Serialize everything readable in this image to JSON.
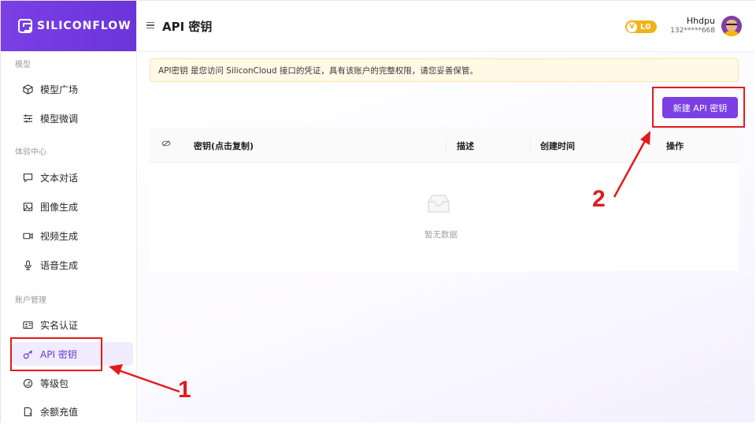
{
  "brand": {
    "logo_text": "SILICONFLOW"
  },
  "sidebar": {
    "sections": [
      {
        "label": "模型"
      },
      {
        "label": "体验中心"
      },
      {
        "label": "账户管理"
      }
    ],
    "items": [
      {
        "label": "模型广场",
        "icon": "cube-icon"
      },
      {
        "label": "模型微调",
        "icon": "sliders-icon"
      },
      {
        "label": "文本对话",
        "icon": "chat-icon"
      },
      {
        "label": "图像生成",
        "icon": "image-icon"
      },
      {
        "label": "视频生成",
        "icon": "video-icon"
      },
      {
        "label": "语音生成",
        "icon": "microphone-icon"
      },
      {
        "label": "实名认证",
        "icon": "id-card-icon"
      },
      {
        "label": "API 密钥",
        "icon": "key-icon",
        "active": true
      },
      {
        "label": "等级包",
        "icon": "gauge-icon"
      },
      {
        "label": "余额充值",
        "icon": "wallet-icon"
      }
    ]
  },
  "header": {
    "title": "API 密钥",
    "level_badge": "L0",
    "user": {
      "name": "Hhdpu",
      "phone": "132*****668"
    }
  },
  "main": {
    "notice": "API密钥 是您访问 SiliconCloud 接口的凭证，具有该账户的完整权限，请您妥善保管。",
    "new_key_button": "新建 API 密钥",
    "table": {
      "columns": [
        "密钥(点击复制)",
        "描述",
        "创建时间",
        "操作"
      ],
      "empty_text": "暂无数据"
    }
  },
  "annotations": {
    "step1": "1",
    "step2": "2"
  },
  "colors": {
    "brand": "#7b3fe4",
    "annotation": "#e21b1b",
    "badge": "#f3b21a",
    "notice_bg": "#fff9e6"
  }
}
